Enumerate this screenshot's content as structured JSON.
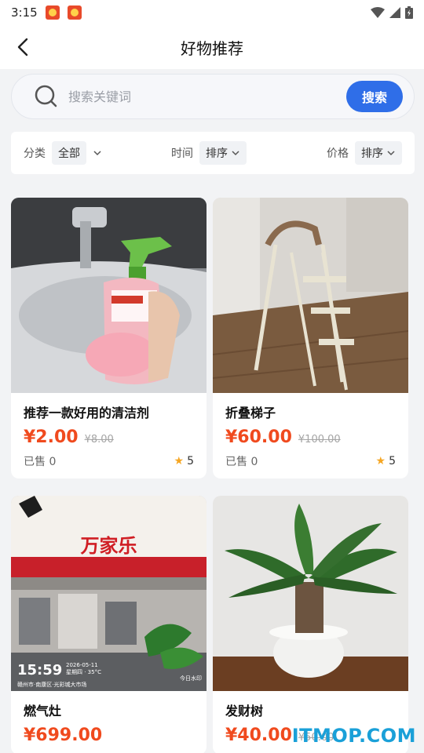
{
  "status_bar": {
    "time": "3:15"
  },
  "header": {
    "title": "好物推荐"
  },
  "search": {
    "placeholder": "搜索关键词",
    "button_label": "搜索"
  },
  "filters": {
    "category": {
      "label": "分类",
      "value": "全部"
    },
    "time": {
      "label": "时间",
      "value": "排序"
    },
    "price": {
      "label": "价格",
      "value": "排序"
    }
  },
  "products": [
    {
      "title": "推荐一款好用的清洁剂",
      "price": "¥2.00",
      "old_price": "¥8.00",
      "sold": "已售 0",
      "rating": "5"
    },
    {
      "title": "折叠梯子",
      "price": "¥60.00",
      "old_price": "¥100.00",
      "sold": "已售 0",
      "rating": "5"
    },
    {
      "title": "燃气灶",
      "price": "¥699.00",
      "old_price": "",
      "sold": "",
      "rating": ""
    },
    {
      "title": "发财树",
      "price": "¥40.00",
      "old_price": "¥50.00",
      "sold": "",
      "rating": ""
    }
  ],
  "images": {
    "stove_sign": "万家乐",
    "stove_time": "15:59",
    "stove_date": "2026-05-11",
    "stove_weekday": "星期四 · 35°C",
    "stove_location": "赣州市·南康区·光彩城大市场",
    "stove_brand": "今日水印"
  },
  "watermark": "ITMOP.COM",
  "colors": {
    "accent": "#2f6ee8",
    "price": "#f04a1e",
    "star": "#f5a623",
    "watermark": "#1aa0d8"
  }
}
